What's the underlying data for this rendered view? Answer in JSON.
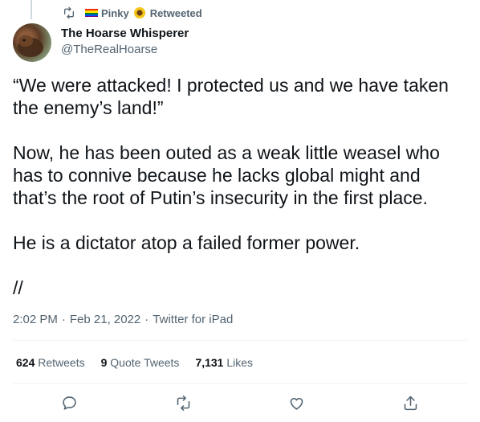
{
  "retweet": {
    "user": "Pinky",
    "label": "Retweeted"
  },
  "author": {
    "display_name": "The Hoarse Whisperer",
    "handle": "@TheRealHoarse"
  },
  "tweet": {
    "text": "“We were attacked! I protected us and we have taken the enemy’s land!”\n\nNow, he has been outed as a weak little weasel who has to connive because he lacks global might and that’s the root of Putin’s insecurity in the first place.\n\nHe is a dictator atop a failed former power.\n\n//"
  },
  "meta": {
    "time": "2:02 PM",
    "date": "Feb 21, 2022",
    "source": "Twitter for iPad",
    "separator": "·"
  },
  "stats": {
    "retweets_count": "624",
    "retweets_label": "Retweets",
    "quotes_count": "9",
    "quotes_label": "Quote Tweets",
    "likes_count": "7,131",
    "likes_label": "Likes"
  },
  "icons": {
    "retweet_indicator": "retweet-icon",
    "reply": "reply-icon",
    "retweet": "retweet-icon",
    "like": "heart-icon",
    "share": "share-icon"
  },
  "colors": {
    "text": "#0f1419",
    "secondary": "#536471",
    "divider": "#eff3f4"
  }
}
